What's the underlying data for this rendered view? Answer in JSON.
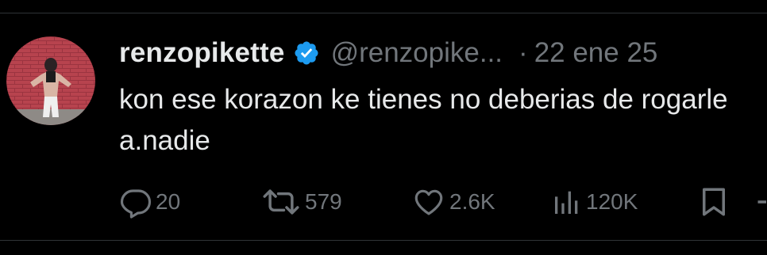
{
  "tweet": {
    "display_name": "renzopikette",
    "handle": "@renzopike...",
    "separator": "·",
    "date": "22 ene 25",
    "verified": true,
    "text": "kon ese korazon ke tienes no deberias de rogarle a.nadie"
  },
  "actions": {
    "replies": "20",
    "retweets": "579",
    "likes": "2.6K",
    "views": "120K"
  },
  "colors": {
    "background": "#000000",
    "primary_text": "#e7e9ea",
    "secondary_text": "#71767b",
    "verified_badge": "#1d9bf0",
    "divider": "#2f3336"
  },
  "icons": {
    "reply": "reply-icon",
    "retweet": "retweet-icon",
    "like": "heart-icon",
    "views": "views-chart-icon",
    "bookmark": "bookmark-icon",
    "share": "share-icon",
    "verified": "verified-badge-icon"
  }
}
